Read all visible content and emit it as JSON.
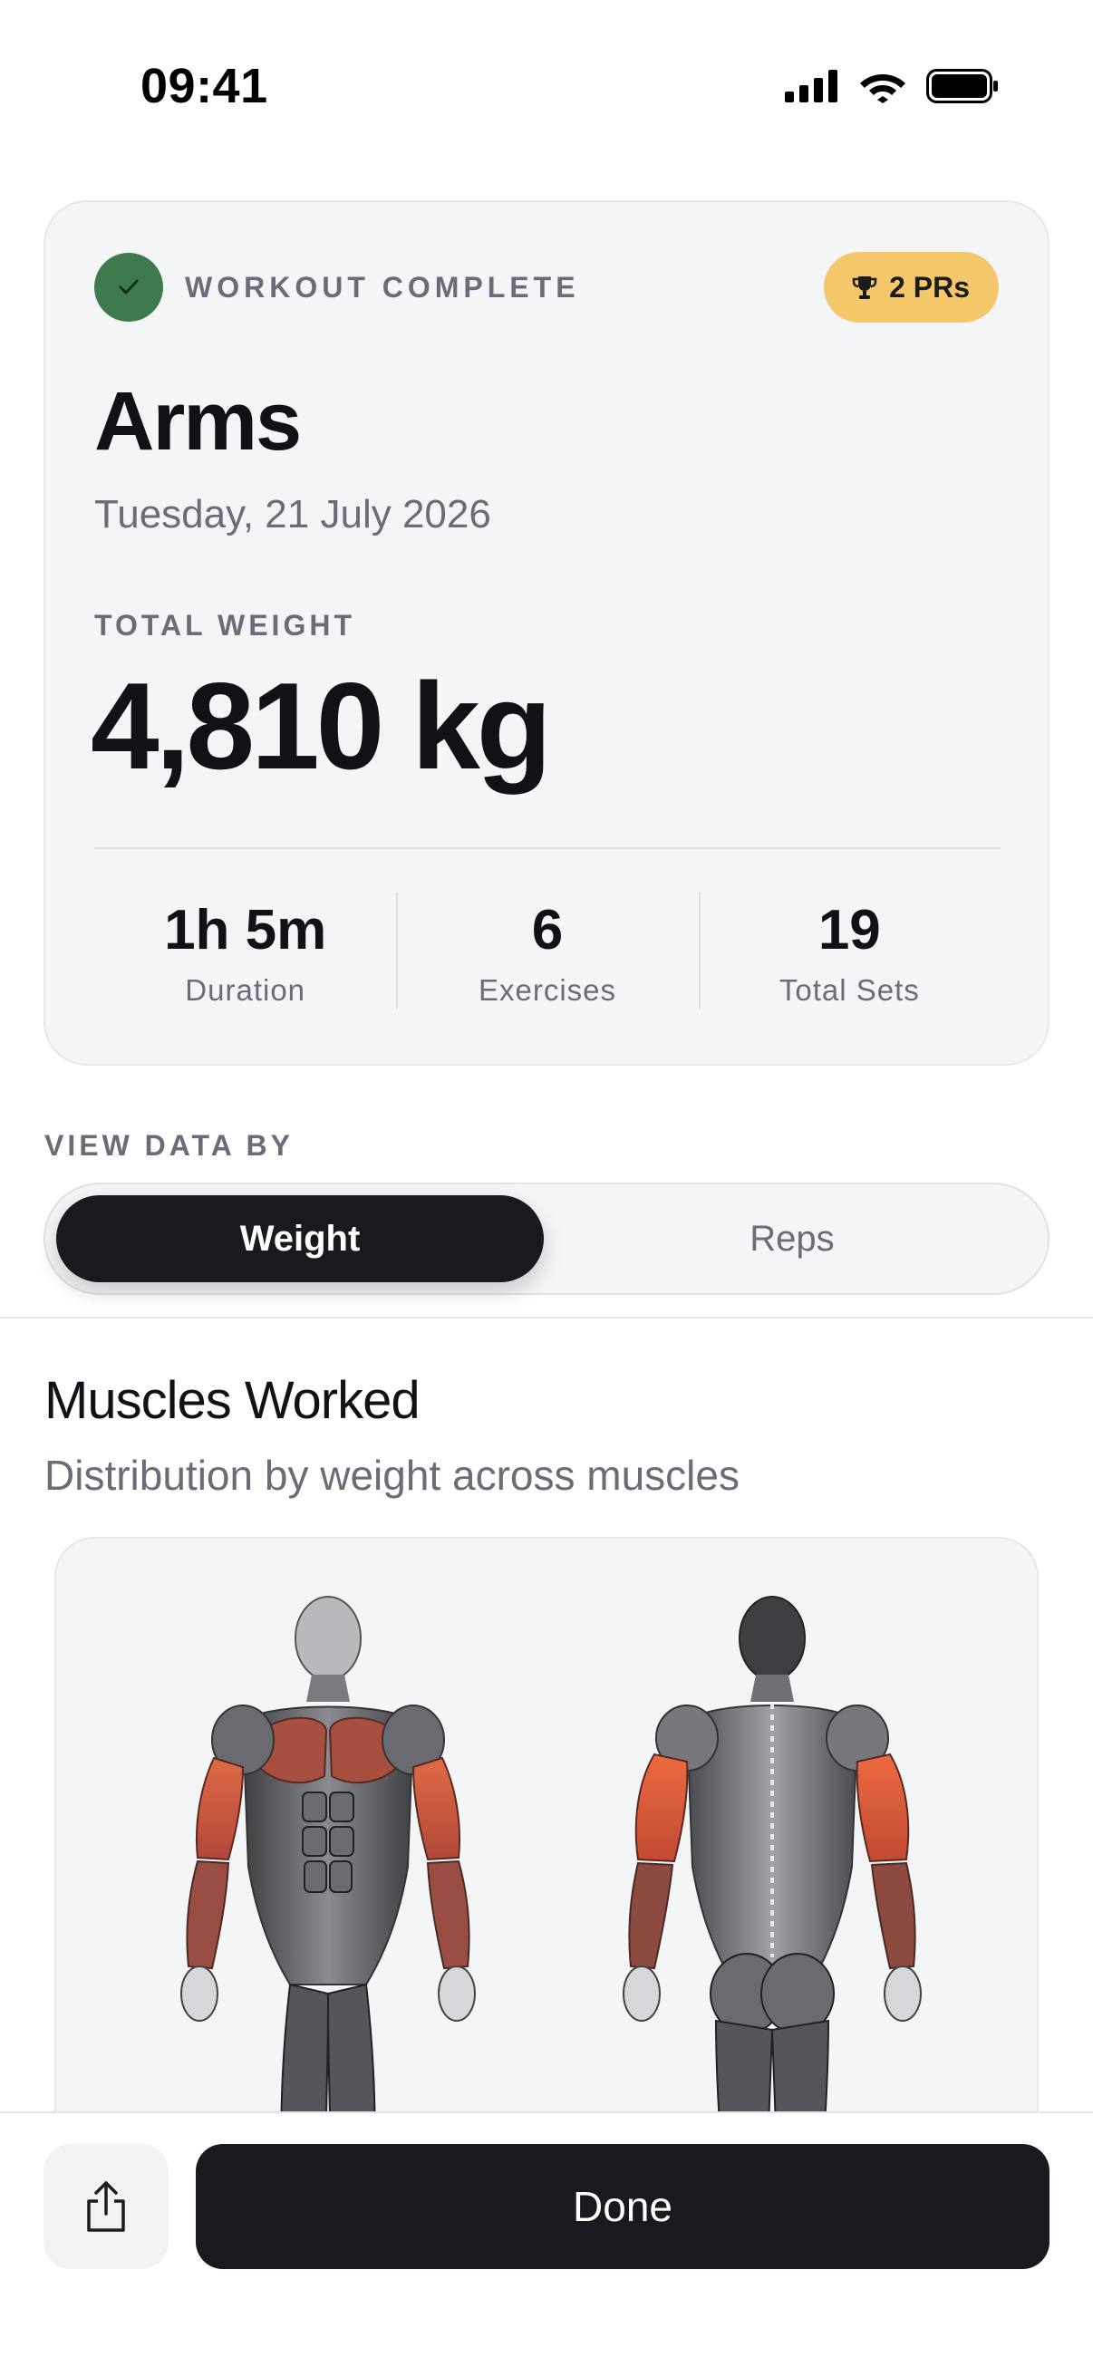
{
  "status_bar": {
    "time": "09:41",
    "icons": [
      "cellular-signal-icon",
      "wifi-icon",
      "battery-icon"
    ]
  },
  "summary": {
    "status_label": "WORKOUT COMPLETE",
    "status_icon": "checkmark-icon",
    "pr_badge": {
      "icon": "trophy-icon",
      "label": "2 PRs"
    },
    "title": "Arms",
    "date": "Tuesday, 21 July 2026",
    "total_weight_label": "TOTAL WEIGHT",
    "total_weight_value": "4,810 kg",
    "stats": [
      {
        "value": "1h 5m",
        "label": "Duration"
      },
      {
        "value": "6",
        "label": "Exercises"
      },
      {
        "value": "19",
        "label": "Total Sets"
      }
    ]
  },
  "view_toggle": {
    "label": "VIEW DATA BY",
    "options": [
      "Weight",
      "Reps"
    ],
    "selected": "Weight"
  },
  "muscles": {
    "title": "Muscles Worked",
    "subtitle": "Distribution by weight across muscles",
    "highlighted": [
      "chest",
      "biceps",
      "forearms",
      "triceps"
    ]
  },
  "footer": {
    "share_icon": "share-icon",
    "done_label": "Done"
  },
  "colors": {
    "accent_dark": "#181a20",
    "success_green": "#3f7a4d",
    "pr_gold": "#f3c76a",
    "muscle_highlight": "#d9583a",
    "card_background": "#f4f5f7"
  }
}
